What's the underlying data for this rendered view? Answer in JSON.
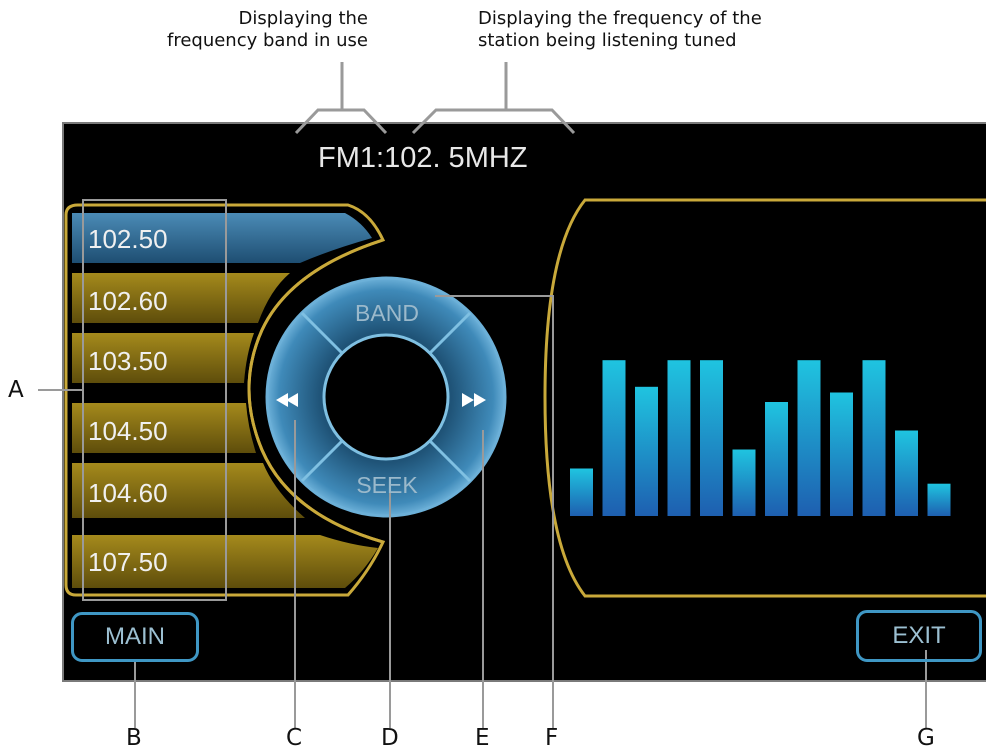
{
  "annotations": {
    "band_line1": "Displaying the",
    "band_line2": "frequency band in use",
    "freq_line1": "Displaying the frequency of the",
    "freq_line2": "station being listening tuned"
  },
  "header": {
    "band": "FM1",
    "separator": ":",
    "frequency": "102. 5MHZ"
  },
  "presets": [
    {
      "label": "102.50",
      "active": true
    },
    {
      "label": "102.60",
      "active": false
    },
    {
      "label": "103.50",
      "active": false
    },
    {
      "label": "104.50",
      "active": false
    },
    {
      "label": "104.60",
      "active": false
    },
    {
      "label": "107.50",
      "active": false
    }
  ],
  "control_wheel": {
    "band_label": "BAND",
    "seek_label": "SEEK",
    "prev_icon": "rewind-icon",
    "next_icon": "fast-forward-icon"
  },
  "buttons": {
    "main_label": "MAIN",
    "exit_label": "EXIT"
  },
  "equalizer": {
    "levels": [
      0.25,
      0.82,
      0.68,
      0.82,
      0.82,
      0.35,
      0.6,
      0.82,
      0.65,
      0.82,
      0.45,
      0.17
    ]
  },
  "callouts": {
    "A": "A",
    "B": "B",
    "C": "C",
    "D": "D",
    "E": "E",
    "F": "F",
    "G": "G"
  },
  "colors": {
    "gold": "#c9a93a",
    "preset_active": "#2f6a94",
    "preset_inactive": "#8a7416",
    "wheel_blue": "#3d86b6",
    "eq_top": "#1fc4e0",
    "eq_bottom": "#1e64b4"
  }
}
